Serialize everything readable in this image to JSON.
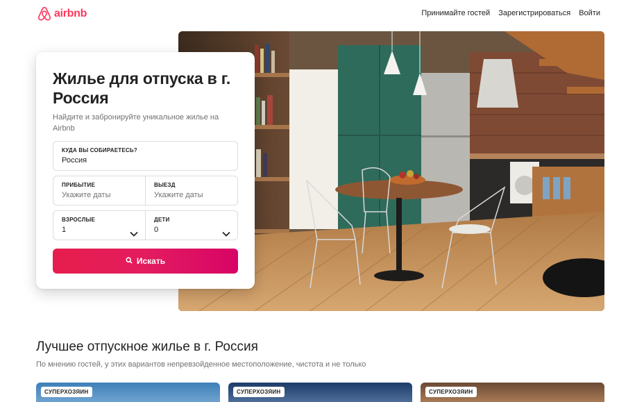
{
  "brand": {
    "name": "airbnb",
    "color": "#FF385C",
    "icon": "airbnb-logo-icon"
  },
  "nav": {
    "host": "Принимайте гостей",
    "signup": "Зарегистрироваться",
    "login": "Войти"
  },
  "search_card": {
    "title": "Жилье для отпуска в г. Россия",
    "subtitle": "Найдите и забронируйте уникальное жилье на Airbnb",
    "destination": {
      "label": "КУДА ВЫ СОБИРАЕТЕСЬ?",
      "value": "Россия"
    },
    "checkin": {
      "label": "ПРИБЫТИЕ",
      "placeholder": "Укажите даты"
    },
    "checkout": {
      "label": "ВЫЕЗД",
      "placeholder": "Укажите даты"
    },
    "adults": {
      "label": "ВЗРОСЛЫЕ",
      "value": "1",
      "icon": "chevron-down-icon"
    },
    "children": {
      "label": "ДЕТИ",
      "value": "0",
      "icon": "chevron-down-icon"
    },
    "search_button": {
      "label": "Искать",
      "icon": "search-icon",
      "color": "#E31C5F"
    }
  },
  "section": {
    "title": "Лучшее отпускное жилье в г. Россия",
    "subtitle": "По мнению гостей, у этих вариантов непревзойденное местоположение, чистота и не только"
  },
  "listings": [
    {
      "badge": "СУПЕРХОЗЯИН"
    },
    {
      "badge": "СУПЕРХОЗЯИН"
    },
    {
      "badge": "СУПЕРХОЗЯИН"
    }
  ]
}
